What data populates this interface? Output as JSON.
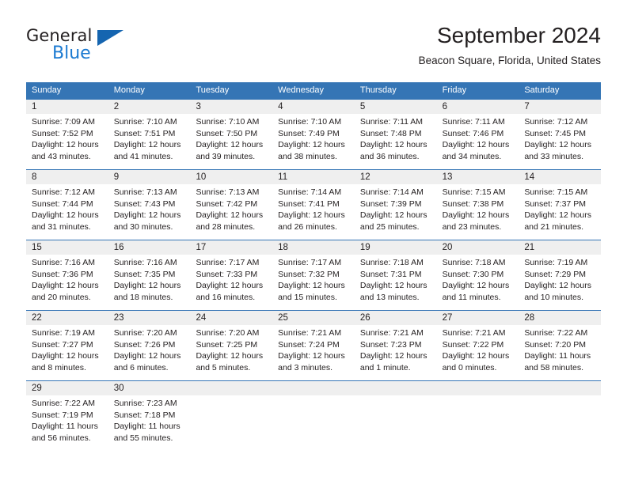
{
  "logo": {
    "word_one": "General",
    "word_two": "Blue",
    "triangle_icon": "triangle-icon",
    "brand_blue": "#1b7ad1",
    "brand_dark": "#231f20"
  },
  "header": {
    "title": "September 2024",
    "subtitle": "Beacon Square, Florida, United States"
  },
  "theme": {
    "header_blue": "#3575b5",
    "day_band_gray": "#efefef",
    "text": "#231f20"
  },
  "calendar": {
    "weekdays": [
      "Sunday",
      "Monday",
      "Tuesday",
      "Wednesday",
      "Thursday",
      "Friday",
      "Saturday"
    ],
    "weeks": [
      [
        {
          "day": "1",
          "sunrise": "Sunrise: 7:09 AM",
          "sunset": "Sunset: 7:52 PM",
          "daylight_1": "Daylight: 12 hours",
          "daylight_2": "and 43 minutes."
        },
        {
          "day": "2",
          "sunrise": "Sunrise: 7:10 AM",
          "sunset": "Sunset: 7:51 PM",
          "daylight_1": "Daylight: 12 hours",
          "daylight_2": "and 41 minutes."
        },
        {
          "day": "3",
          "sunrise": "Sunrise: 7:10 AM",
          "sunset": "Sunset: 7:50 PM",
          "daylight_1": "Daylight: 12 hours",
          "daylight_2": "and 39 minutes."
        },
        {
          "day": "4",
          "sunrise": "Sunrise: 7:10 AM",
          "sunset": "Sunset: 7:49 PM",
          "daylight_1": "Daylight: 12 hours",
          "daylight_2": "and 38 minutes."
        },
        {
          "day": "5",
          "sunrise": "Sunrise: 7:11 AM",
          "sunset": "Sunset: 7:48 PM",
          "daylight_1": "Daylight: 12 hours",
          "daylight_2": "and 36 minutes."
        },
        {
          "day": "6",
          "sunrise": "Sunrise: 7:11 AM",
          "sunset": "Sunset: 7:46 PM",
          "daylight_1": "Daylight: 12 hours",
          "daylight_2": "and 34 minutes."
        },
        {
          "day": "7",
          "sunrise": "Sunrise: 7:12 AM",
          "sunset": "Sunset: 7:45 PM",
          "daylight_1": "Daylight: 12 hours",
          "daylight_2": "and 33 minutes."
        }
      ],
      [
        {
          "day": "8",
          "sunrise": "Sunrise: 7:12 AM",
          "sunset": "Sunset: 7:44 PM",
          "daylight_1": "Daylight: 12 hours",
          "daylight_2": "and 31 minutes."
        },
        {
          "day": "9",
          "sunrise": "Sunrise: 7:13 AM",
          "sunset": "Sunset: 7:43 PM",
          "daylight_1": "Daylight: 12 hours",
          "daylight_2": "and 30 minutes."
        },
        {
          "day": "10",
          "sunrise": "Sunrise: 7:13 AM",
          "sunset": "Sunset: 7:42 PM",
          "daylight_1": "Daylight: 12 hours",
          "daylight_2": "and 28 minutes."
        },
        {
          "day": "11",
          "sunrise": "Sunrise: 7:14 AM",
          "sunset": "Sunset: 7:41 PM",
          "daylight_1": "Daylight: 12 hours",
          "daylight_2": "and 26 minutes."
        },
        {
          "day": "12",
          "sunrise": "Sunrise: 7:14 AM",
          "sunset": "Sunset: 7:39 PM",
          "daylight_1": "Daylight: 12 hours",
          "daylight_2": "and 25 minutes."
        },
        {
          "day": "13",
          "sunrise": "Sunrise: 7:15 AM",
          "sunset": "Sunset: 7:38 PM",
          "daylight_1": "Daylight: 12 hours",
          "daylight_2": "and 23 minutes."
        },
        {
          "day": "14",
          "sunrise": "Sunrise: 7:15 AM",
          "sunset": "Sunset: 7:37 PM",
          "daylight_1": "Daylight: 12 hours",
          "daylight_2": "and 21 minutes."
        }
      ],
      [
        {
          "day": "15",
          "sunrise": "Sunrise: 7:16 AM",
          "sunset": "Sunset: 7:36 PM",
          "daylight_1": "Daylight: 12 hours",
          "daylight_2": "and 20 minutes."
        },
        {
          "day": "16",
          "sunrise": "Sunrise: 7:16 AM",
          "sunset": "Sunset: 7:35 PM",
          "daylight_1": "Daylight: 12 hours",
          "daylight_2": "and 18 minutes."
        },
        {
          "day": "17",
          "sunrise": "Sunrise: 7:17 AM",
          "sunset": "Sunset: 7:33 PM",
          "daylight_1": "Daylight: 12 hours",
          "daylight_2": "and 16 minutes."
        },
        {
          "day": "18",
          "sunrise": "Sunrise: 7:17 AM",
          "sunset": "Sunset: 7:32 PM",
          "daylight_1": "Daylight: 12 hours",
          "daylight_2": "and 15 minutes."
        },
        {
          "day": "19",
          "sunrise": "Sunrise: 7:18 AM",
          "sunset": "Sunset: 7:31 PM",
          "daylight_1": "Daylight: 12 hours",
          "daylight_2": "and 13 minutes."
        },
        {
          "day": "20",
          "sunrise": "Sunrise: 7:18 AM",
          "sunset": "Sunset: 7:30 PM",
          "daylight_1": "Daylight: 12 hours",
          "daylight_2": "and 11 minutes."
        },
        {
          "day": "21",
          "sunrise": "Sunrise: 7:19 AM",
          "sunset": "Sunset: 7:29 PM",
          "daylight_1": "Daylight: 12 hours",
          "daylight_2": "and 10 minutes."
        }
      ],
      [
        {
          "day": "22",
          "sunrise": "Sunrise: 7:19 AM",
          "sunset": "Sunset: 7:27 PM",
          "daylight_1": "Daylight: 12 hours",
          "daylight_2": "and 8 minutes."
        },
        {
          "day": "23",
          "sunrise": "Sunrise: 7:20 AM",
          "sunset": "Sunset: 7:26 PM",
          "daylight_1": "Daylight: 12 hours",
          "daylight_2": "and 6 minutes."
        },
        {
          "day": "24",
          "sunrise": "Sunrise: 7:20 AM",
          "sunset": "Sunset: 7:25 PM",
          "daylight_1": "Daylight: 12 hours",
          "daylight_2": "and 5 minutes."
        },
        {
          "day": "25",
          "sunrise": "Sunrise: 7:21 AM",
          "sunset": "Sunset: 7:24 PM",
          "daylight_1": "Daylight: 12 hours",
          "daylight_2": "and 3 minutes."
        },
        {
          "day": "26",
          "sunrise": "Sunrise: 7:21 AM",
          "sunset": "Sunset: 7:23 PM",
          "daylight_1": "Daylight: 12 hours",
          "daylight_2": "and 1 minute."
        },
        {
          "day": "27",
          "sunrise": "Sunrise: 7:21 AM",
          "sunset": "Sunset: 7:22 PM",
          "daylight_1": "Daylight: 12 hours",
          "daylight_2": "and 0 minutes."
        },
        {
          "day": "28",
          "sunrise": "Sunrise: 7:22 AM",
          "sunset": "Sunset: 7:20 PM",
          "daylight_1": "Daylight: 11 hours",
          "daylight_2": "and 58 minutes."
        }
      ],
      [
        {
          "day": "29",
          "sunrise": "Sunrise: 7:22 AM",
          "sunset": "Sunset: 7:19 PM",
          "daylight_1": "Daylight: 11 hours",
          "daylight_2": "and 56 minutes."
        },
        {
          "day": "30",
          "sunrise": "Sunrise: 7:23 AM",
          "sunset": "Sunset: 7:18 PM",
          "daylight_1": "Daylight: 11 hours",
          "daylight_2": "and 55 minutes."
        },
        {
          "day": "",
          "sunrise": "",
          "sunset": "",
          "daylight_1": "",
          "daylight_2": ""
        },
        {
          "day": "",
          "sunrise": "",
          "sunset": "",
          "daylight_1": "",
          "daylight_2": ""
        },
        {
          "day": "",
          "sunrise": "",
          "sunset": "",
          "daylight_1": "",
          "daylight_2": ""
        },
        {
          "day": "",
          "sunrise": "",
          "sunset": "",
          "daylight_1": "",
          "daylight_2": ""
        },
        {
          "day": "",
          "sunrise": "",
          "sunset": "",
          "daylight_1": "",
          "daylight_2": ""
        }
      ]
    ]
  }
}
